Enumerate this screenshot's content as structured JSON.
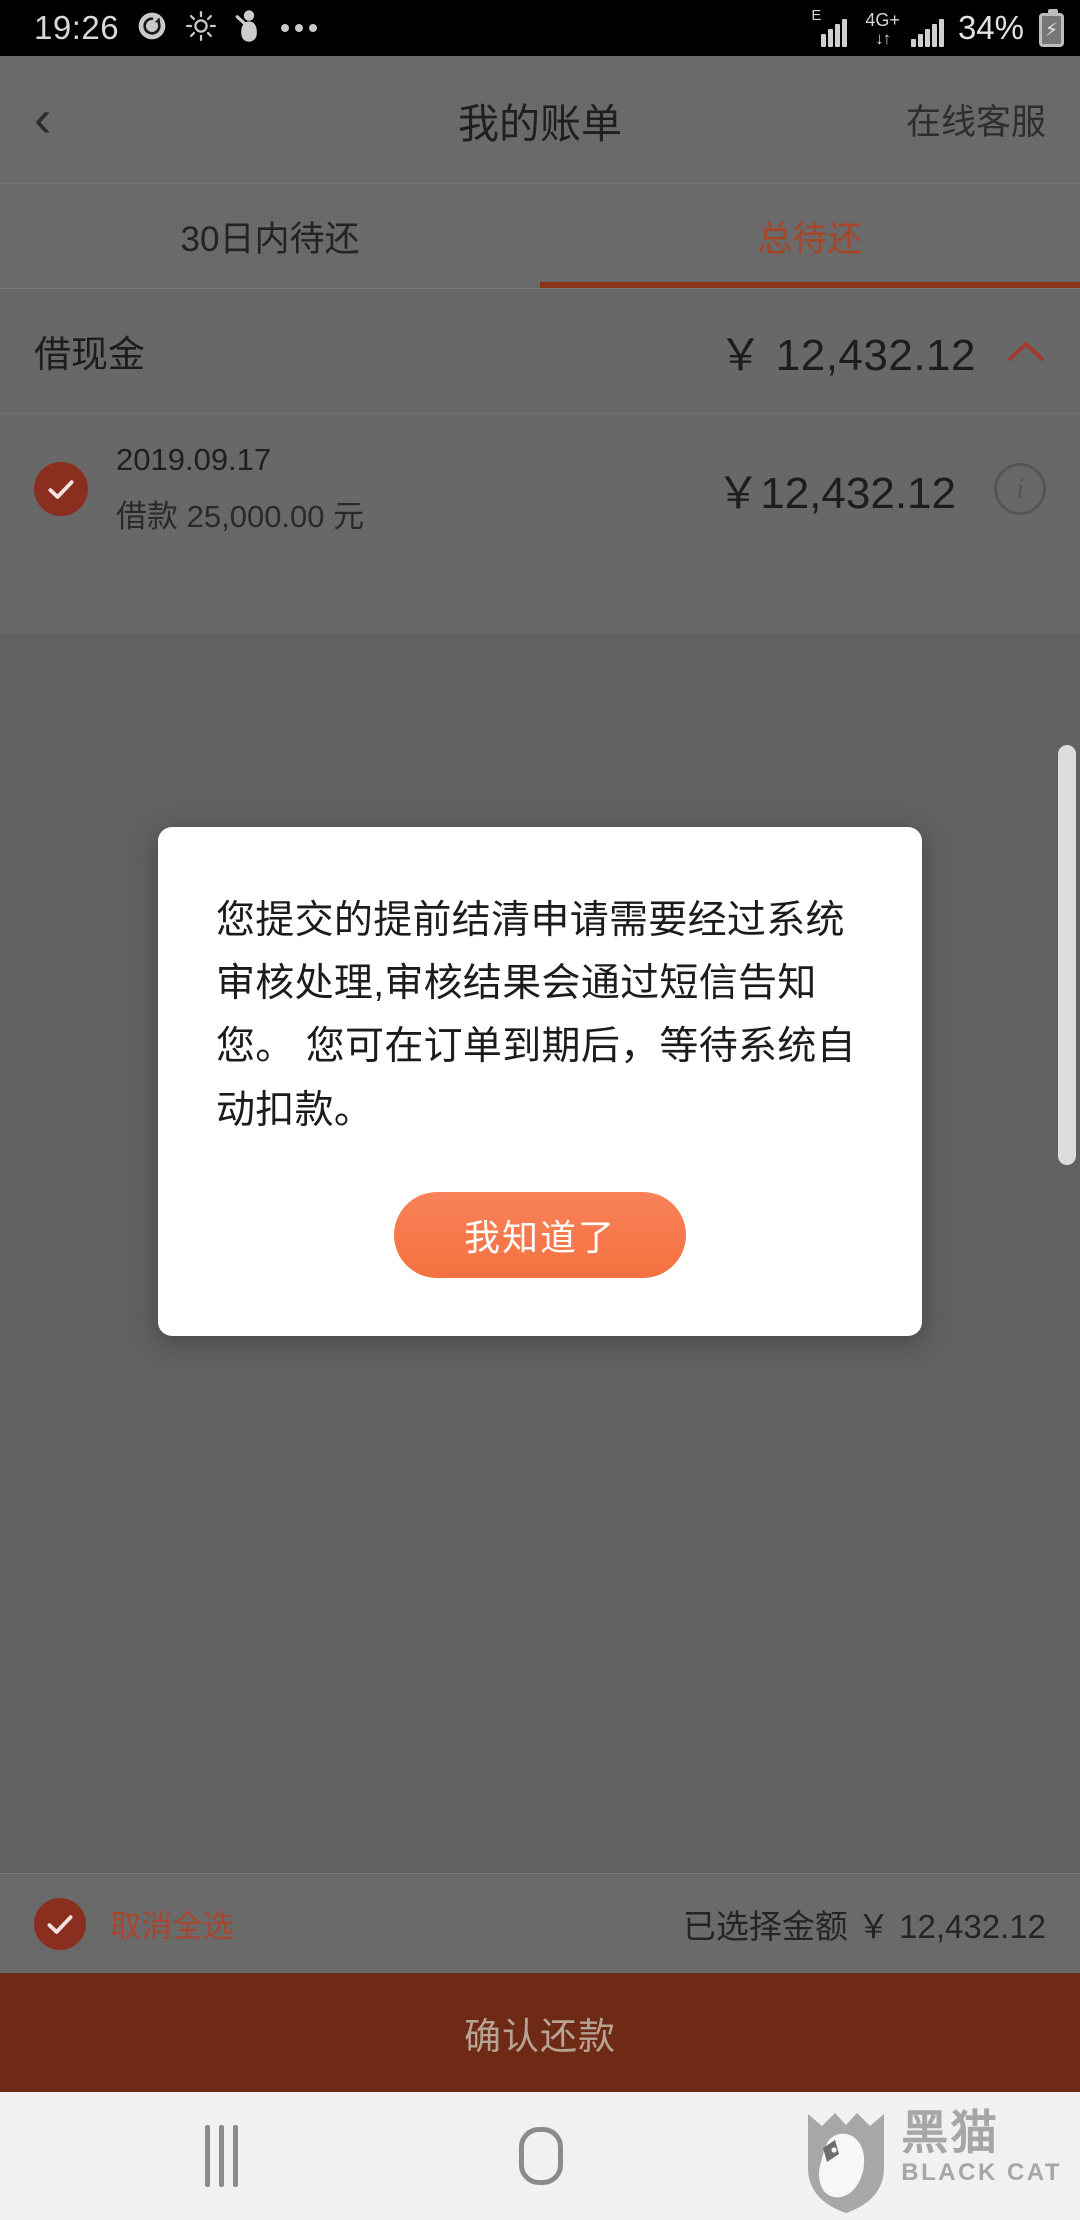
{
  "status_bar": {
    "time": "19:26",
    "left_icons": [
      "alarm-refresh-icon",
      "brightness-icon",
      "do-not-disturb-icon",
      "more-dots-icon"
    ],
    "signal_label": "E",
    "network_label": "4G+",
    "battery_percent": "34%",
    "battery_state": "charging"
  },
  "header": {
    "back_label": "‹",
    "title": "我的账单",
    "action_label": "在线客服"
  },
  "tabs": [
    {
      "label": "30日内待还",
      "active": false
    },
    {
      "label": "总待还",
      "active": true
    }
  ],
  "bill_group": {
    "name": "借现金",
    "amount": "￥ 12,432.12",
    "collapse_icon": "chevron-up-icon"
  },
  "bill_items": [
    {
      "checked": true,
      "date": "2019.09.17",
      "principal": "借款 25,000.00 元",
      "amount": "￥12,432.12",
      "info_icon": "info-icon"
    }
  ],
  "modal": {
    "message": "您提交的提前结清申请需要经过系统审核处理,审核结果会通过短信告知您。 您可在订单到期后，等待系统自动扣款。",
    "confirm_label": "我知道了",
    "button_color": "#f4713f"
  },
  "bottom_bar": {
    "select_all_label": "取消全选",
    "selected_checked": true,
    "total_label": "已选择金额 ￥ 12,432.12"
  },
  "confirm_button": {
    "label": "确认还款",
    "disabled": true,
    "background": "#6e2a14"
  },
  "nav_bar": {
    "recents_icon": "recents-icon",
    "home_icon": "home-icon"
  },
  "watermark": {
    "cn": "黑猫",
    "en": "BLACK CAT"
  },
  "colors": {
    "accent": "#f4713f",
    "tab_active": "#a94527",
    "scrim": "#616161",
    "panel": "#6a6a6a"
  }
}
